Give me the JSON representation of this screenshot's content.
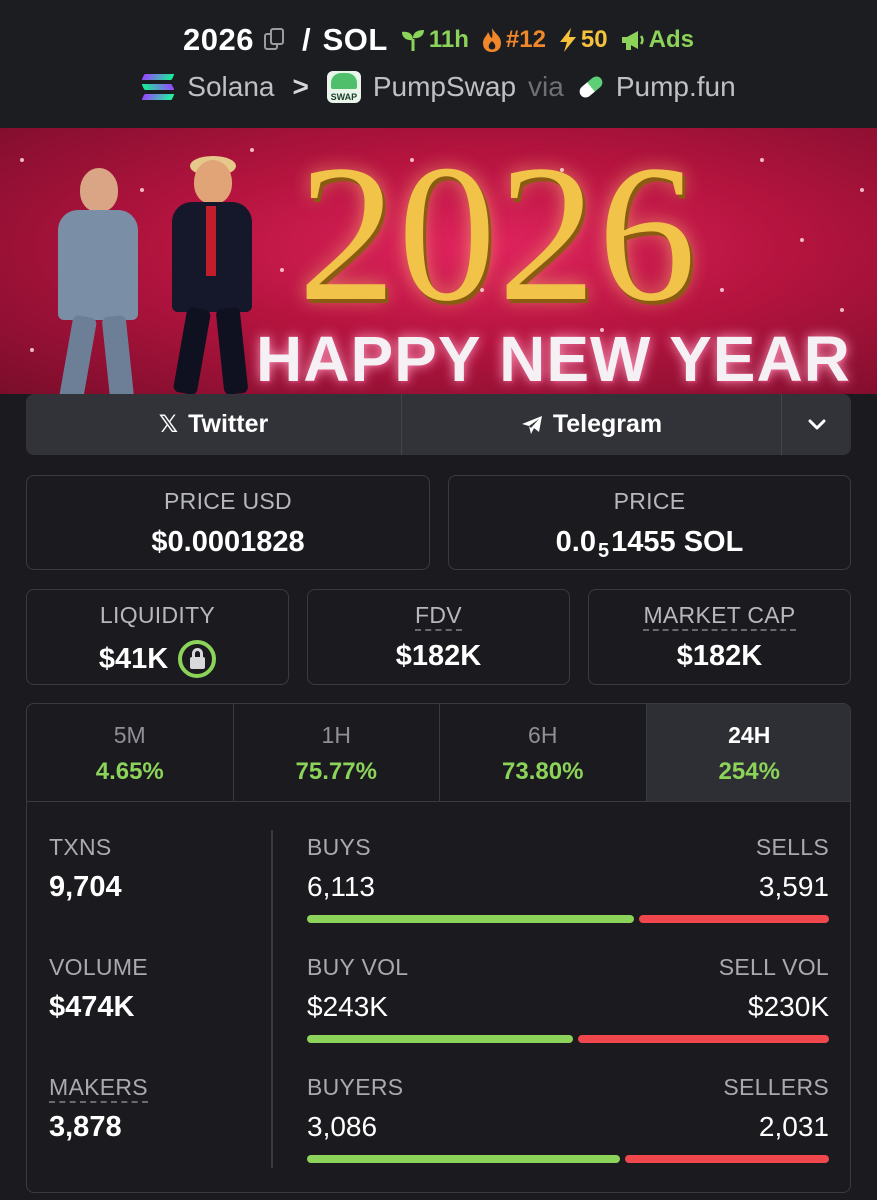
{
  "header": {
    "token": "2026",
    "quote": "SOL",
    "age": "11h",
    "rank": "#12",
    "boost": "50",
    "ads": "Ads",
    "chain": "Solana",
    "dex": "PumpSwap",
    "via": "via",
    "launchpad": "Pump.fun",
    "dex_logo_text": "SWAP"
  },
  "banner": {
    "year": "2026",
    "greeting": "HAPPY NEW YEAR"
  },
  "socials": {
    "twitter": "Twitter",
    "telegram": "Telegram"
  },
  "stats": {
    "price_usd_label": "PRICE USD",
    "price_usd": "$0.0001828",
    "price_label": "PRICE",
    "price_prefix": "0.0",
    "price_zeros": "5",
    "price_suffix": "1455 SOL",
    "liquidity_label": "LIQUIDITY",
    "liquidity": "$41K",
    "fdv_label": "FDV",
    "fdv": "$182K",
    "mcap_label": "MARKET CAP",
    "mcap": "$182K"
  },
  "timeframes": [
    {
      "label": "5M",
      "change": "4.65%"
    },
    {
      "label": "1H",
      "change": "75.77%"
    },
    {
      "label": "6H",
      "change": "73.80%"
    },
    {
      "label": "24H",
      "change": "254%"
    }
  ],
  "active_timeframe": "24H",
  "activity": {
    "txns_label": "TXNS",
    "txns": "9,704",
    "volume_label": "VOLUME",
    "volume": "$474K",
    "makers_label": "MAKERS",
    "makers": "3,878",
    "buys_label": "BUYS",
    "buys": "6,113",
    "sells_label": "SELLS",
    "sells": "3,591",
    "buy_vol_label": "BUY VOL",
    "buy_vol": "$243K",
    "sell_vol_label": "SELL VOL",
    "sell_vol": "$230K",
    "buyers_label": "BUYERS",
    "buyers": "3,086",
    "sellers_label": "SELLERS",
    "sellers": "2,031"
  },
  "bars": {
    "buys_ratio": 0.63,
    "buy_vol_ratio": 0.514,
    "buyers_ratio": 0.603
  },
  "colors": {
    "accent_green": "#8cd35a",
    "accent_red": "#f0474c",
    "background": "#1b1b1f"
  }
}
